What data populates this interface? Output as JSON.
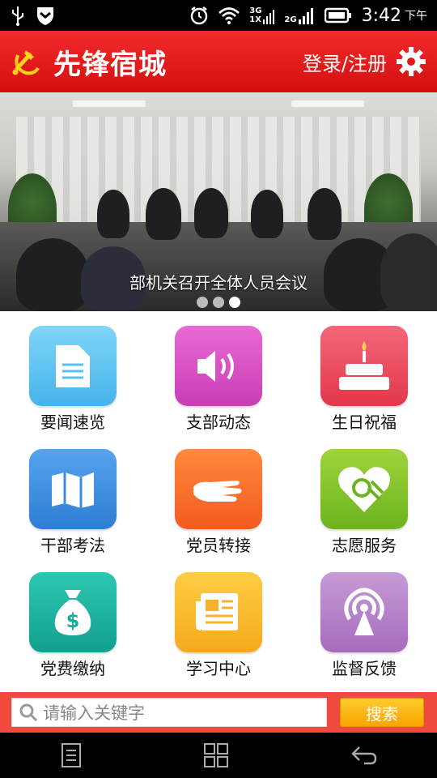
{
  "status_bar": {
    "time": "3:42",
    "ampm": "下午",
    "network_3g": "3G",
    "network_1x": "1X",
    "network_2g": "2G"
  },
  "header": {
    "title": "先锋宿城",
    "login_label": "登录/注册"
  },
  "banner": {
    "caption": "部机关召开全体人员会议",
    "slide_count": 3,
    "active_slide": 3
  },
  "grid": {
    "tiles": [
      {
        "label": "要闻速览",
        "icon": "document-icon",
        "color": "#5fc4f0"
      },
      {
        "label": "支部动态",
        "icon": "speaker-icon",
        "color": "#d84fc4"
      },
      {
        "label": "生日祝福",
        "icon": "cake-icon",
        "color": "#ec4b5d"
      },
      {
        "label": "干部考法",
        "icon": "map-icon",
        "color": "#3f8fe0"
      },
      {
        "label": "党员转接",
        "icon": "hand-icon",
        "color": "#f7692d"
      },
      {
        "label": "志愿服务",
        "icon": "heart-emblem-icon",
        "color": "#84c42a"
      },
      {
        "label": "党费缴纳",
        "icon": "money-bag-icon",
        "color": "#1fb3a0"
      },
      {
        "label": "学习中心",
        "icon": "newspaper-icon",
        "color": "#f8b62a"
      },
      {
        "label": "监督反馈",
        "icon": "broadcast-icon",
        "color": "#b57fc9"
      }
    ]
  },
  "search": {
    "placeholder": "请输入关键字",
    "button_label": "搜索"
  }
}
